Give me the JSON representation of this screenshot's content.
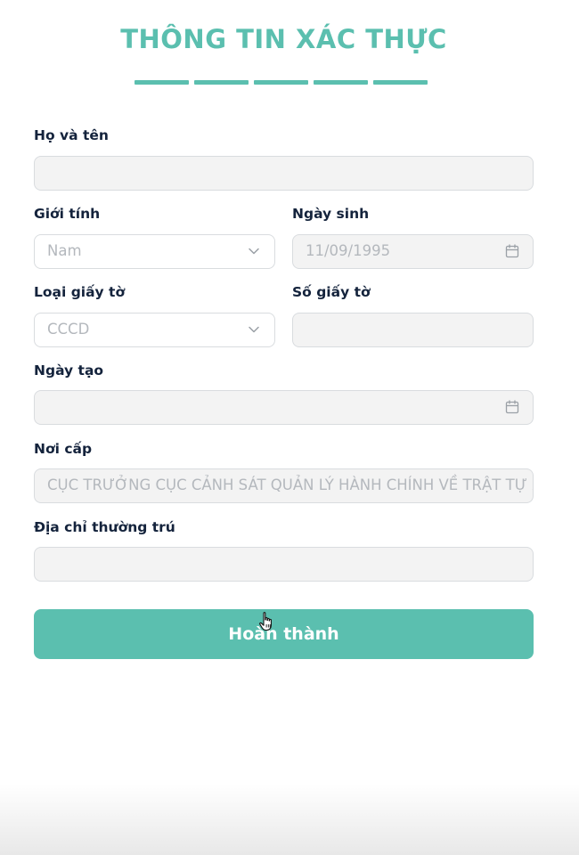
{
  "header": {
    "title": "THÔNG TIN XÁC THỰC",
    "progress_steps": 5,
    "accent_color": "#5bbfaf"
  },
  "form": {
    "full_name": {
      "label": "Họ và tên",
      "value": ""
    },
    "gender": {
      "label": "Giới tính",
      "value": "Nam",
      "icon": "chevron-down-icon"
    },
    "birth_date": {
      "label": "Ngày sinh",
      "value": "11/09/1995",
      "icon": "calendar-icon"
    },
    "document_type": {
      "label": "Loại giấy tờ",
      "value": "CCCD",
      "icon": "chevron-down-icon"
    },
    "document_number": {
      "label": "Số giấy tờ",
      "value": ""
    },
    "issue_date": {
      "label": "Ngày tạo",
      "value": "",
      "icon": "calendar-icon"
    },
    "issue_place": {
      "label": "Nơi cấp",
      "value": "CỤC TRƯỞNG CỤC CẢNH SÁT QUẢN LÝ HÀNH CHÍNH VỀ TRẬT TỰ XÃ HỘI"
    },
    "permanent_address": {
      "label": "Địa chỉ thường trú",
      "value": ""
    }
  },
  "actions": {
    "submit_label": "Hoàn thành"
  }
}
